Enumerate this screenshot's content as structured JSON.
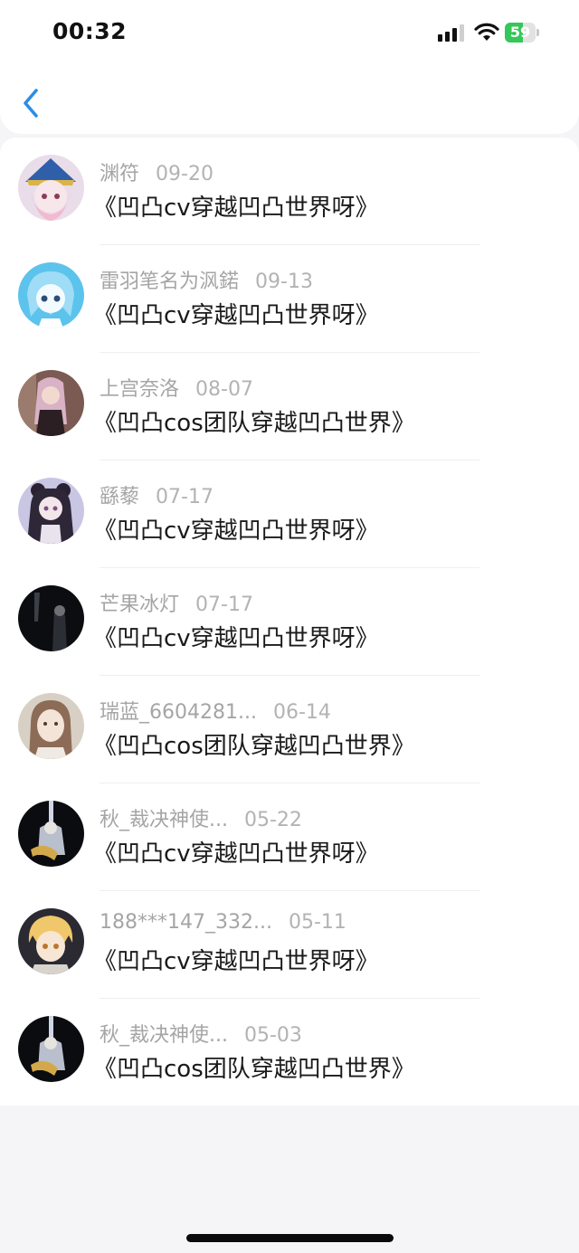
{
  "status_bar": {
    "time": "00:32",
    "battery": "59",
    "battery_level": 0.59
  },
  "header": {
    "back_icon": "chevron-left-icon",
    "accent": "#2a8ee8"
  },
  "items": [
    {
      "name": "渊符",
      "date": "09-20",
      "title": "《凹凸cv穿越凹凸世界呀》"
    },
    {
      "name": "雷羽笔名为沨鍩",
      "date": "09-13",
      "title": "《凹凸cv穿越凹凸世界呀》"
    },
    {
      "name": "上宫奈洛",
      "date": "08-07",
      "title": "《凹凸cos团队穿越凹凸世界》"
    },
    {
      "name": "繇藜",
      "date": "07-17",
      "title": "《凹凸cv穿越凹凸世界呀》"
    },
    {
      "name": "芒果冰灯",
      "date": "07-17",
      "title": "《凹凸cv穿越凹凸世界呀》"
    },
    {
      "name": "瑞蓝_6604281...",
      "date": "06-14",
      "title": "《凹凸cos团队穿越凹凸世界》"
    },
    {
      "name": "秋_裁决神使...",
      "date": "05-22",
      "title": "《凹凸cv穿越凹凸世界呀》"
    },
    {
      "name": "188***147_332...",
      "date": "05-11",
      "title": "《凹凸cv穿越凹凸世界呀》"
    },
    {
      "name": "秋_裁决神使...",
      "date": "05-03",
      "title": "《凹凸cos团队穿越凹凸世界》"
    }
  ]
}
